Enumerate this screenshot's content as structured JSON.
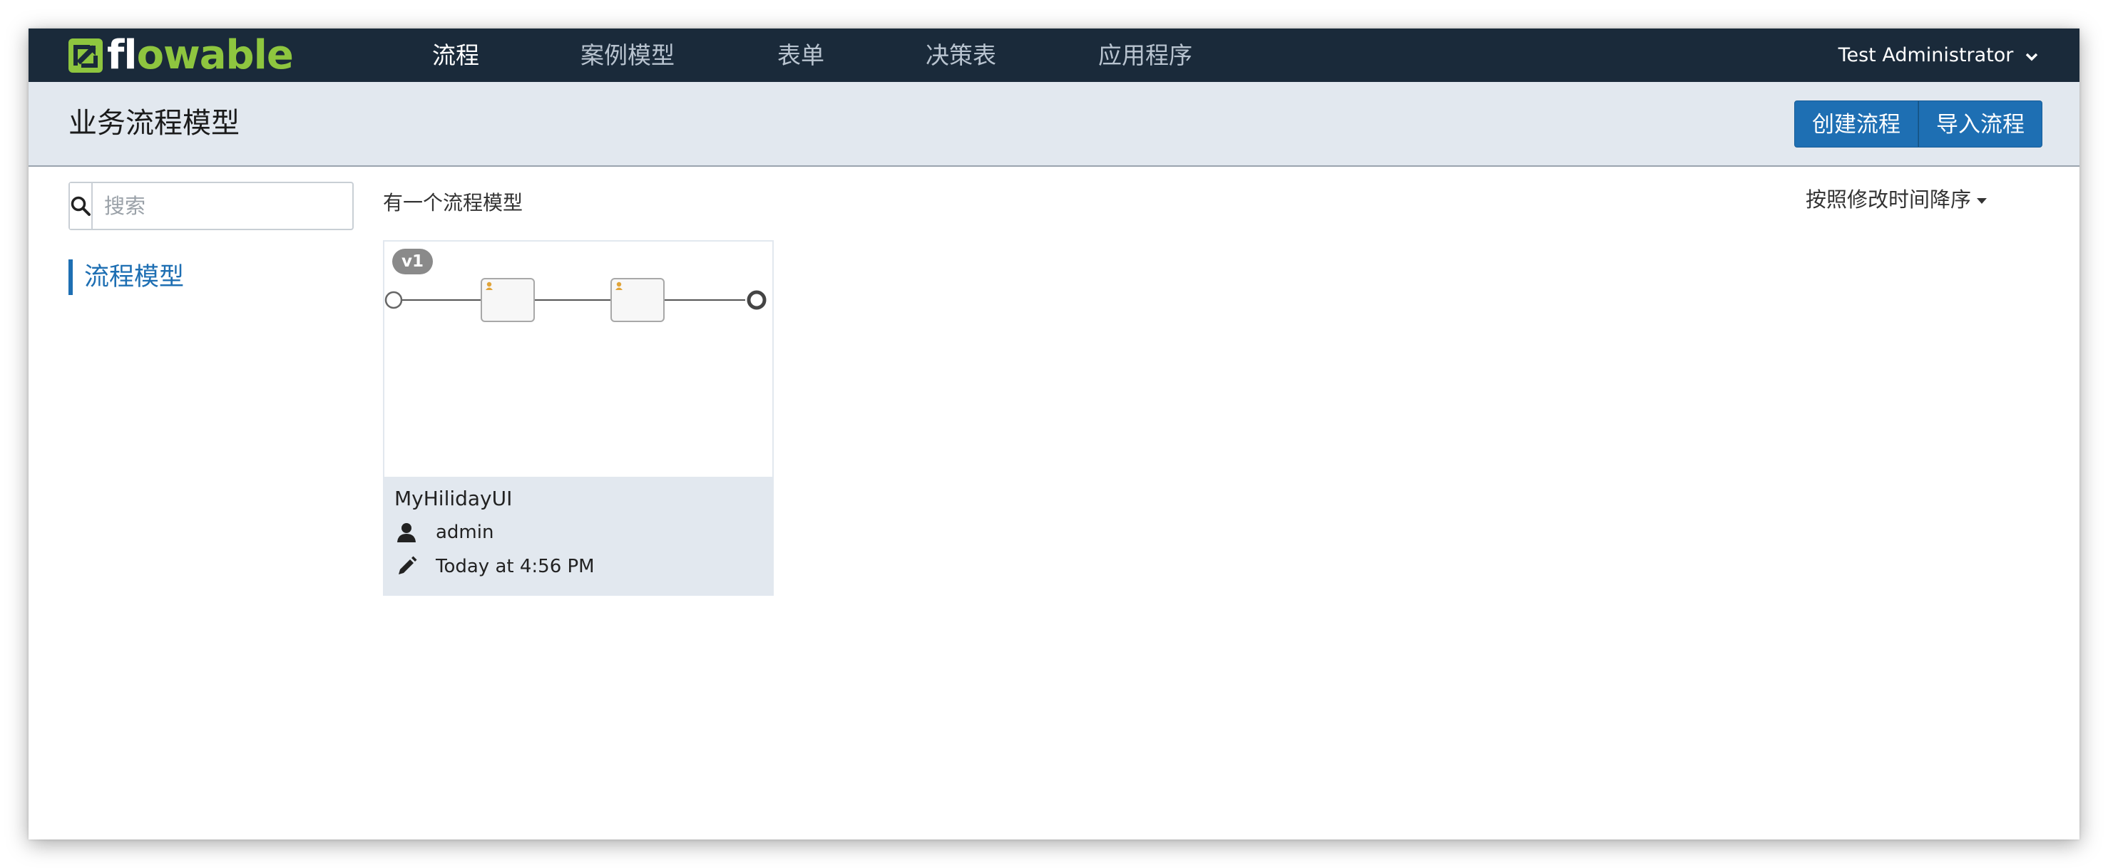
{
  "app": {
    "logo_text_a": "fl",
    "logo_text_b": "owable",
    "brand_color": "#8ec63f",
    "accent_color": "#1e6fb3",
    "nav_bg": "#1a2a3a"
  },
  "nav": {
    "tabs": [
      {
        "label": "流程",
        "active": true
      },
      {
        "label": "案例模型",
        "active": false
      },
      {
        "label": "表单",
        "active": false
      },
      {
        "label": "决策表",
        "active": false
      },
      {
        "label": "应用程序",
        "active": false
      }
    ],
    "user": "Test Administrator"
  },
  "header": {
    "title": "业务流程模型",
    "create_button": "创建流程",
    "import_button": "导入流程"
  },
  "sidebar": {
    "search_placeholder": "搜索",
    "items": [
      {
        "label": "流程模型",
        "active": true
      }
    ]
  },
  "main": {
    "count_text": "有一个流程模型",
    "sort_label": "按照修改时间降序",
    "models": [
      {
        "version": "v1",
        "name": "MyHilidayUI",
        "author": "admin",
        "modified": "Today at 4:56 PM"
      }
    ]
  }
}
